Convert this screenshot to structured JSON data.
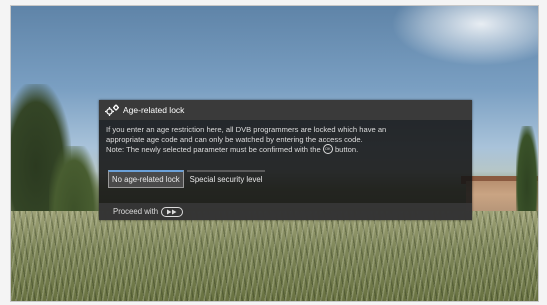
{
  "dialog": {
    "title": "Age-related lock",
    "icon": "gear-icon",
    "description_line1": "If you enter an age restriction here, all DVB programmers are locked which have an",
    "description_line2": "appropriate age code and can only be watched by entering the access code.",
    "description_line3_prefix": "Note: The newly selected parameter must be confirmed with the",
    "ok_icon_text": "OK",
    "description_line3_suffix": "button.",
    "options": [
      {
        "label": "No age-related lock",
        "selected": true
      },
      {
        "label": "Special security level",
        "selected": false
      }
    ],
    "footer": {
      "proceed_label": "Proceed with",
      "proceed_icon": "forward-button-icon"
    }
  },
  "colors": {
    "dialog_background": "#141414",
    "title_bar": "#3a3a3a",
    "selected_accent": "#6aa0d8"
  }
}
